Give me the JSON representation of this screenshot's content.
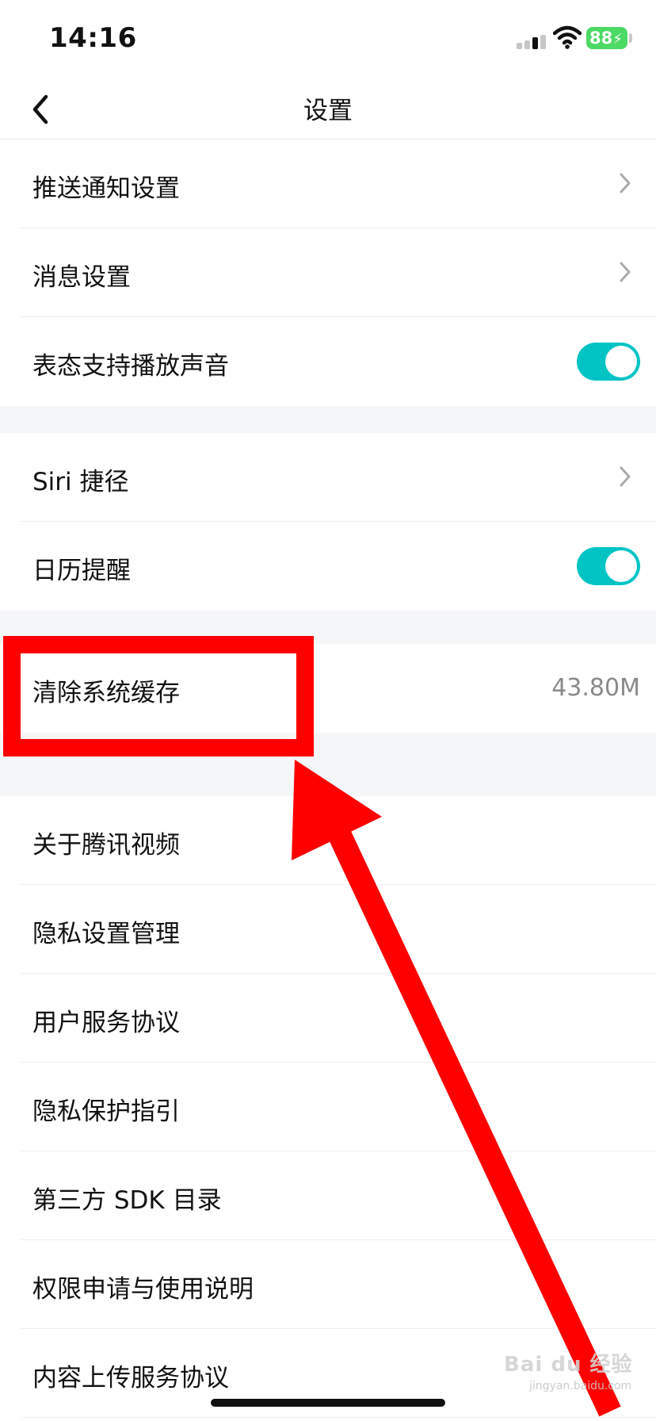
{
  "status_bar": {
    "time": "14:16",
    "battery": "88"
  },
  "nav": {
    "title": "设置"
  },
  "group1": {
    "items": [
      {
        "label": "推送通知设置"
      },
      {
        "label": "消息设置"
      },
      {
        "label": "表态支持播放声音"
      }
    ]
  },
  "group2": {
    "items": [
      {
        "label": "Siri 捷径"
      },
      {
        "label": "日历提醒"
      }
    ]
  },
  "group3": {
    "items": [
      {
        "label": "清除系统缓存",
        "value": "43.80M"
      }
    ]
  },
  "group4": {
    "items": [
      {
        "label": "关于腾讯视频"
      },
      {
        "label": "隐私设置管理"
      },
      {
        "label": "用户服务协议"
      },
      {
        "label": "隐私保护指引"
      },
      {
        "label": "第三方 SDK 目录"
      },
      {
        "label": "权限申请与使用说明"
      },
      {
        "label": "内容上传服务协议"
      }
    ]
  },
  "toggles": {
    "sound_on": true,
    "calendar_on": true
  },
  "colors": {
    "toggle_on": "#00c4c4",
    "annotation": "#ff0000",
    "section_gap": "#f5f6f8"
  },
  "watermark": {
    "text": "Bai du 经验",
    "sub": "jingyan.baidu.com"
  }
}
